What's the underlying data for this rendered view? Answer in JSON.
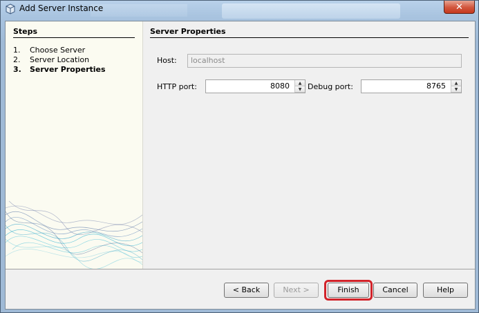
{
  "window": {
    "title": "Add Server Instance",
    "close_glyph": "✕"
  },
  "steps": {
    "title": "Steps",
    "items": [
      {
        "num": "1.",
        "label": "Choose Server"
      },
      {
        "num": "2.",
        "label": "Server Location"
      },
      {
        "num": "3.",
        "label": "Server Properties"
      }
    ]
  },
  "main": {
    "title": "Server Properties",
    "host_label": "Host:",
    "host_value": "localhost",
    "http_port_label": "HTTP port:",
    "http_port_value": "8080",
    "debug_port_label": "Debug port:",
    "debug_port_value": "8765"
  },
  "buttons": {
    "back": "< Back",
    "next": "Next >",
    "finish": "Finish",
    "cancel": "Cancel",
    "help": "Help"
  },
  "colors": {
    "highlight": "#d2232a",
    "steps_bg": "#fbfbf1",
    "close_button": "#d2553c"
  }
}
